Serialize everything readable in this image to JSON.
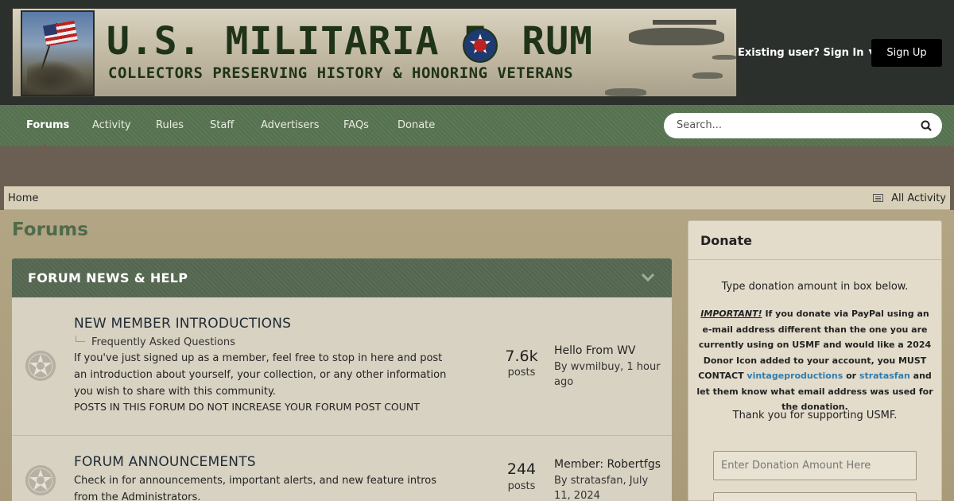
{
  "header": {
    "banner_title": "U.S. MILITARIA F",
    "banner_title_end": "RUM",
    "banner_subtitle": "COLLECTORS PRESERVING HISTORY & HONORING VETERANS",
    "signin_label": "Existing user? Sign In",
    "signup_label": "Sign Up"
  },
  "nav": {
    "items": [
      "Forums",
      "Activity",
      "Rules",
      "Staff",
      "Advertisers",
      "FAQs",
      "Donate"
    ],
    "active": "Forums"
  },
  "search": {
    "placeholder": "Search..."
  },
  "breadcrumb": {
    "home": "Home",
    "all_activity": "All Activity"
  },
  "page": {
    "title": "Forums"
  },
  "category": {
    "title": "FORUM NEWS & HELP",
    "forums": [
      {
        "name": "NEW MEMBER INTRODUCTIONS",
        "subforum": "Frequently Asked Questions",
        "description": "If you've just signed up as a member, feel free to stop in here and post an introduction about yourself, your collection, or any other information you wish to share with this community.",
        "note": "POSTS IN THIS FORUM DO NOT INCREASE YOUR FORUM POST COUNT",
        "posts_count": "7.6k",
        "posts_label": "posts",
        "last_post_title": "Hello From WV",
        "last_post_meta": "By wvmilbuy, 1 hour ago"
      },
      {
        "name": "FORUM ANNOUNCEMENTS",
        "description": "Check in for announcements, important alerts, and new feature intros from the Administrators.",
        "posts_count": "244",
        "posts_label": "posts",
        "last_post_title": "Member: Robertfgs",
        "last_post_meta": "By stratasfan, July 11, 2024"
      }
    ]
  },
  "sidebar": {
    "title": "Donate",
    "intro": "Type donation amount in box below.",
    "important_label": "IMPORTANT!",
    "important_text_1": " If you donate via PayPal using an e-mail address different than the one you are currently using on USMF and would like a 2024 Donor Icon added to your account, you MUST CONTACT ",
    "link_1": "vintageproductions",
    "or_text": " or ",
    "link_2": "stratasfan",
    "important_text_2": " and let them know what email address was used for the donation.",
    "thanks": "Thank you for supporting USMF.",
    "donation_placeholder": "Enter Donation Amount Here"
  },
  "colors": {
    "header_bg": "#2b302c",
    "nav_green": "#55704f",
    "category_green": "#53654f",
    "page_title_green": "#4e6b4a",
    "link_blue": "#2f7db0"
  }
}
